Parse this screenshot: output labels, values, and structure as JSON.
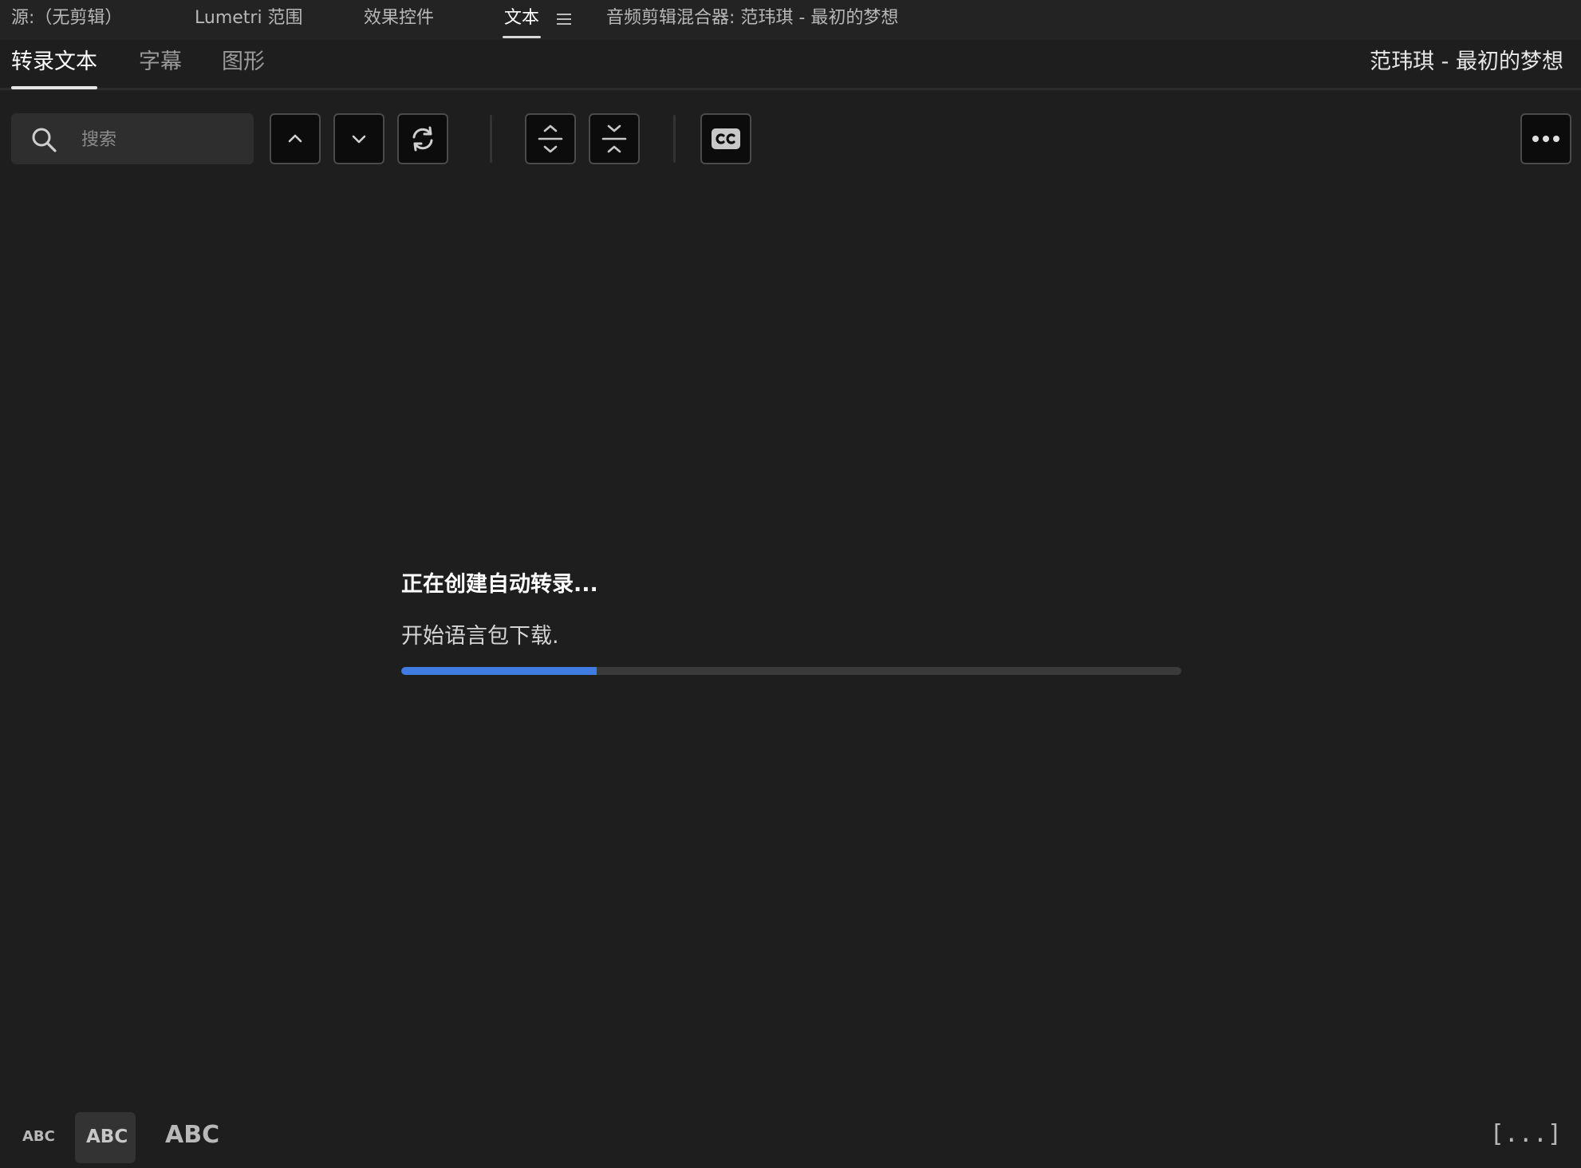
{
  "panel_tabs": [
    {
      "label": "源:（无剪辑）"
    },
    {
      "label": "Lumetri 范围"
    },
    {
      "label": "效果控件"
    },
    {
      "label": "文本"
    },
    {
      "label": "音频剪辑混合器: 范玮琪 - 最初的梦想"
    }
  ],
  "panel_tabs_active": "文本",
  "sub_tabs": [
    {
      "label": "转录文本"
    },
    {
      "label": "字幕"
    },
    {
      "label": "图形"
    }
  ],
  "sub_tabs_active": "转录文本",
  "sequence_name": "范玮琪 - 最初的梦想",
  "search": {
    "placeholder": "搜索",
    "value": ""
  },
  "toolbar_icons": [
    "chevron-up-icon",
    "chevron-down-icon",
    "refresh-icon",
    "expand-all-icon",
    "collapse-all-icon",
    "closed-captions-icon",
    "more-options-icon"
  ],
  "status": {
    "title": "正在创建自动转录...",
    "message": "开始语言包下载.",
    "progress": 0.25
  },
  "bottom": {
    "text_size_small": "ABC",
    "text_size_medium": "ABC",
    "text_size_large": "ABC",
    "text_size_selected": "medium",
    "expand_label": "[...]"
  },
  "colors": {
    "background": "#1e1e1e",
    "accent": "#3f7be0",
    "tab_bar": "#232323"
  }
}
